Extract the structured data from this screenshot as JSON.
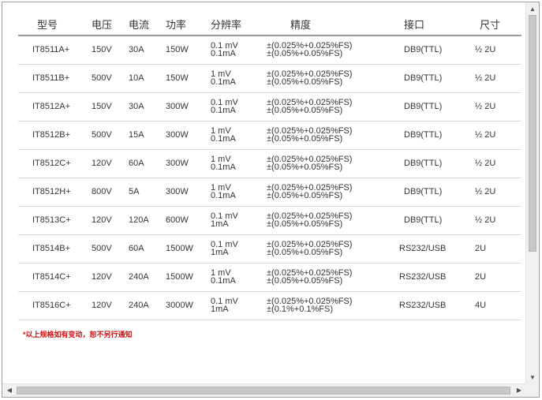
{
  "table": {
    "headers": {
      "model": "型号",
      "voltage": "电压",
      "current": "电流",
      "power": "功率",
      "resolution": "分辨率",
      "accuracy": "精度",
      "interface": "接口",
      "size": "尺寸"
    },
    "rows": [
      {
        "model": "IT8511A+",
        "voltage": "150V",
        "current": "30A",
        "power": "150W",
        "res1": "0.1 mV",
        "res2": "0.1mA",
        "acc1": "±(0.025%+0.025%FS)",
        "acc2": "±(0.05%+0.05%FS)",
        "interface": "DB9(TTL)",
        "size": "½ 2U"
      },
      {
        "model": "IT8511B+",
        "voltage": "500V",
        "current": "10A",
        "power": "150W",
        "res1": "1 mV",
        "res2": "0.1mA",
        "acc1": "±(0.025%+0.025%FS)",
        "acc2": "±(0.05%+0.05%FS)",
        "interface": "DB9(TTL)",
        "size": "½ 2U"
      },
      {
        "model": "IT8512A+",
        "voltage": "150V",
        "current": "30A",
        "power": "300W",
        "res1": "0.1 mV",
        "res2": "0.1mA",
        "acc1": "±(0.025%+0.025%FS)",
        "acc2": "±(0.05%+0.05%FS)",
        "interface": "DB9(TTL)",
        "size": "½ 2U"
      },
      {
        "model": "IT8512B+",
        "voltage": "500V",
        "current": "15A",
        "power": "300W",
        "res1": "1 mV",
        "res2": "0.1mA",
        "acc1": "±(0.025%+0.025%FS)",
        "acc2": "±(0.05%+0.05%FS)",
        "interface": "DB9(TTL)",
        "size": "½ 2U"
      },
      {
        "model": "IT8512C+",
        "voltage": "120V",
        "current": "60A",
        "power": "300W",
        "res1": "1 mV",
        "res2": "0.1mA",
        "acc1": "±(0.025%+0.025%FS)",
        "acc2": "±(0.05%+0.05%FS)",
        "interface": "DB9(TTL)",
        "size": "½ 2U"
      },
      {
        "model": "IT8512H+",
        "voltage": "800V",
        "current": "5A",
        "power": "300W",
        "res1": "1 mV",
        "res2": "0.1mA",
        "acc1": "±(0.025%+0.025%FS)",
        "acc2": "±(0.05%+0.05%FS)",
        "interface": "DB9(TTL)",
        "size": "½ 2U"
      },
      {
        "model": "IT8513C+",
        "voltage": "120V",
        "current": "120A",
        "power": "600W",
        "res1": "0.1 mV",
        "res2": "1mA",
        "acc1": "±(0.025%+0.025%FS)",
        "acc2": "±(0.05%+0.05%FS)",
        "interface": "DB9(TTL)",
        "size": "½ 2U"
      },
      {
        "model": "IT8514B+",
        "voltage": "500V",
        "current": "60A",
        "power": "1500W",
        "res1": "0.1 mV",
        "res2": "1mA",
        "acc1": "±(0.025%+0.025%FS)",
        "acc2": "±(0.05%+0.05%FS)",
        "interface": "RS232/USB",
        "size": "2U"
      },
      {
        "model": "IT8514C+",
        "voltage": "120V",
        "current": "240A",
        "power": "1500W",
        "res1": "1 mV",
        "res2": "0.1mA",
        "acc1": "±(0.025%+0.025%FS)",
        "acc2": "±(0.05%+0.05%FS)",
        "interface": "RS232/USB",
        "size": "2U"
      },
      {
        "model": "IT8516C+",
        "voltage": "120V",
        "current": "240A",
        "power": "3000W",
        "res1": "0.1 mV",
        "res2": "1mA",
        "acc1": "±(0.025%+0.025%FS)",
        "acc2": "±(0.1%+0.1%FS)",
        "interface": "RS232/USB",
        "size": "4U"
      }
    ]
  },
  "note": "*以上规格如有变动，恕不另行通知",
  "scrollbars": {
    "up_arrow": "▲",
    "down_arrow": "▼",
    "left_arrow": "◀",
    "right_arrow": "▶"
  },
  "colors": {
    "note": "#d01010",
    "header_rule": "#9a9a9a",
    "row_rule": "#d8d8d8"
  }
}
